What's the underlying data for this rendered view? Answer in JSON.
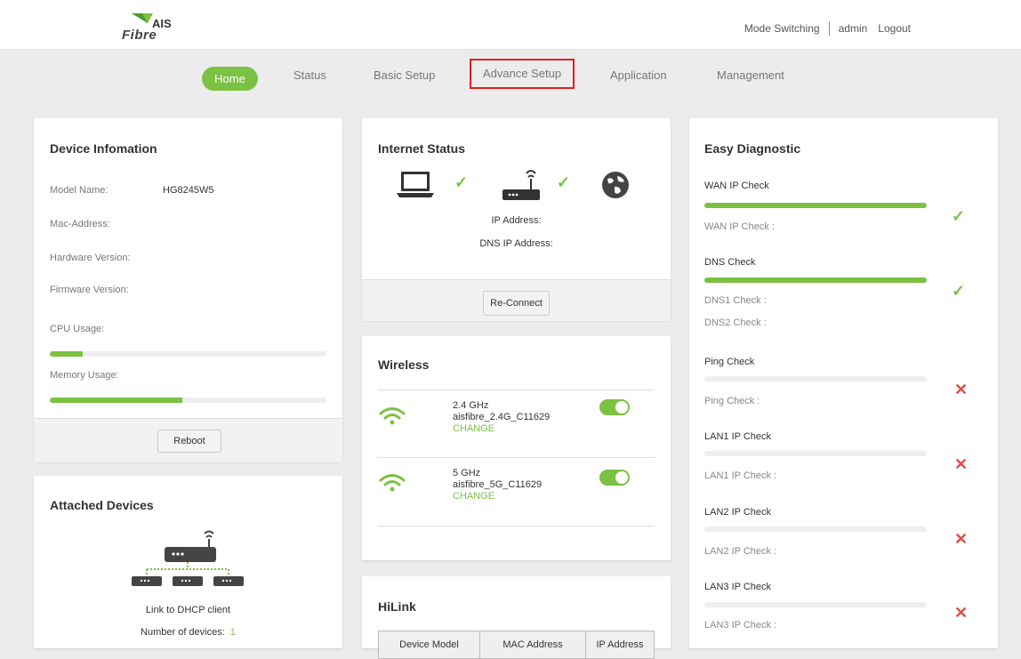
{
  "header": {
    "logo_ais": "AIS",
    "logo_fibre": "Fibre",
    "mode_switching": "Mode Switching",
    "user": "admin",
    "logout": "Logout"
  },
  "nav": {
    "home": "Home",
    "status": "Status",
    "basic_setup": "Basic Setup",
    "advance_setup": "Advance Setup",
    "application": "Application",
    "management": "Management"
  },
  "device_info": {
    "title": "Device Infomation",
    "model_label": "Model Name:",
    "model_value": "HG8245W5",
    "mac_label": "Mac-Address:",
    "hw_label": "Hardware Version:",
    "fw_label": "Firmware Version:",
    "cpu_label": "CPU Usage:",
    "cpu_usage": 0.12,
    "mem_label": "Memory Usage:",
    "memory_usage": 0.48,
    "reboot": "Reboot"
  },
  "attached": {
    "title": "Attached Devices",
    "link_text": "Link to DHCP client",
    "count_label": "Number of devices:",
    "count_value": "1"
  },
  "internet": {
    "title": "Internet Status",
    "ip_label": "IP Address:",
    "dns_label": "DNS IP Address:",
    "reconnect": "Re-Connect"
  },
  "wireless": {
    "title": "Wireless",
    "bands": [
      {
        "freq": "2.4 GHz",
        "ssid": "aisfibre_2.4G_C11629",
        "change": "CHANGE"
      },
      {
        "freq": "5 GHz",
        "ssid": "aisfibre_5G_C11629",
        "change": "CHANGE"
      }
    ]
  },
  "hilink": {
    "title": "HiLink",
    "columns": [
      "Device Model",
      "MAC Address",
      "IP Address"
    ]
  },
  "diagnostic": {
    "title": "Easy Diagnostic",
    "checks": [
      {
        "title": "WAN IP Check",
        "subs": [
          "WAN IP Check :"
        ],
        "progress": 1.0,
        "status": "ok"
      },
      {
        "title": "DNS Check",
        "subs": [
          "DNS1 Check :",
          "DNS2 Check :"
        ],
        "progress": 1.0,
        "status": "ok"
      },
      {
        "title": "Ping Check",
        "subs": [
          "Ping Check :"
        ],
        "progress": 0.0,
        "status": "fail"
      },
      {
        "title": "LAN1 IP Check",
        "subs": [
          "LAN1 IP Check :"
        ],
        "progress": 0.0,
        "status": "fail"
      },
      {
        "title": "LAN2 IP Check",
        "subs": [
          "LAN2 IP Check :"
        ],
        "progress": 0.0,
        "status": "fail"
      },
      {
        "title": "LAN3 IP Check",
        "subs": [
          "LAN3 IP Check :"
        ],
        "progress": 0.0,
        "status": "fail"
      }
    ]
  },
  "colors": {
    "accent": "#7bc142",
    "fail": "#e04a4a",
    "highlight": "#e0201c"
  }
}
